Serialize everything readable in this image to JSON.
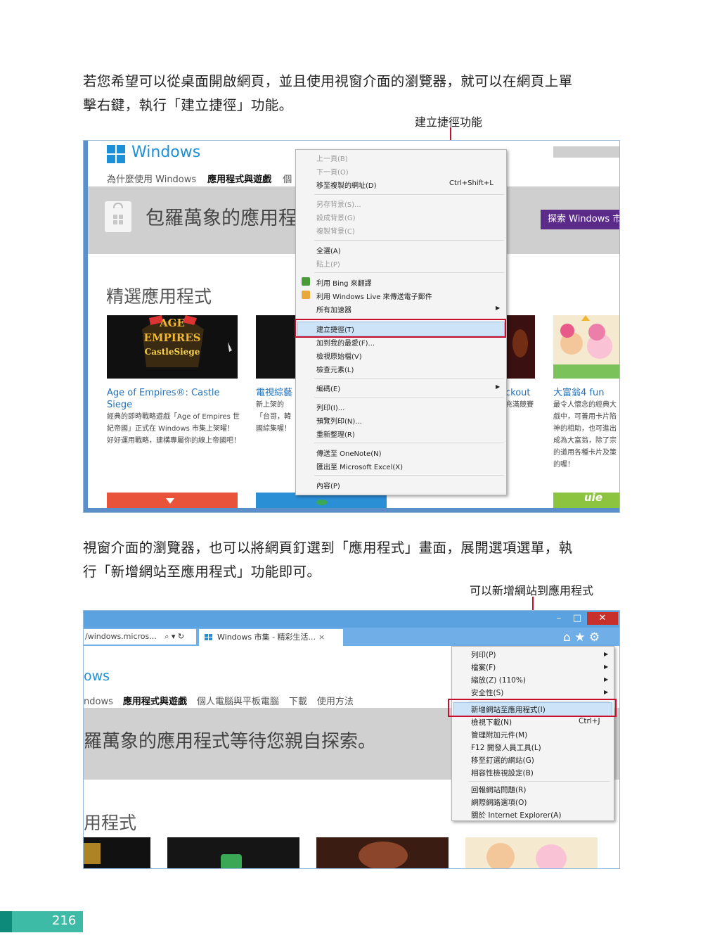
{
  "para1": {
    "line1": "若您希望可以從桌面開啟網頁，並且使用視窗介面的瀏覽器，就可以在網頁上單",
    "line2": "擊右鍵，執行「建立捷徑」功能。"
  },
  "callout1": "建立捷徑功能",
  "shot1": {
    "brand": "Windows",
    "nav_item1": "為什麼使用 Windows",
    "nav_item2": "應用程式與遊戲",
    "nav_item3": "個",
    "hero": "包羅萬象的應用程式",
    "explore": "探索 Windows 市",
    "section": "精選應用程式",
    "apps": [
      {
        "title": "Age of Empires®: Castle Siege",
        "desc": "經典的即時戰略遊戲「Age of Empires 世紀帝國」正式在 Windows 市集上架曜！好好運用戰略，建構專屬你的線上帝國吧！"
      },
      {
        "title": "電視綜藝",
        "desc": "新上架的「台哥，韓國綜集喔！"
      },
      {
        "title": "ckout",
        "desc": "充滿競賽"
      },
      {
        "title": "大富翁4 fun",
        "desc": "最令人懷念的經典大戲中，可善用卡片陷神的相助，也可進出成為大富翁，除了宗的道用各種卡片及策的喔！"
      }
    ],
    "tile_logo": {
      "line1": "AGE",
      "line2": "EMPIRES",
      "line3": "CastleSiege"
    },
    "tile_bottom_text": "uie",
    "menu": {
      "back": "上一頁(B)",
      "forward": "下一頁(O)",
      "goto_copied": "移至複製的網址(D)",
      "goto_copied_shortcut": "Ctrl+Shift+L",
      "save_bg": "另存背景(S)...",
      "set_bg": "設成背景(G)",
      "copy_bg": "複製背景(C)",
      "select_all": "全選(A)",
      "paste": "貼上(P)",
      "bing": "利用 Bing 來翻譯",
      "email": "利用 Windows Live 來傳送電子郵件",
      "accelerators": "所有加速器",
      "create_shortcut": "建立捷徑(T)",
      "add_favorites": "加到我的最愛(F)...",
      "view_source": "檢視原始檔(V)",
      "inspect": "檢查元素(L)",
      "encoding": "編碼(E)",
      "print": "列印(I)...",
      "print_preview": "預覽列印(N)...",
      "refresh": "重新整理(R)",
      "onenote": "傳送至 OneNote(N)",
      "excel": "匯出至 Microsoft Excel(X)",
      "properties": "內容(P)"
    }
  },
  "para2": {
    "line1": "視窗介面的瀏覽器，也可以將網頁釘選到「應用程式」畫面，展開選項選單，執",
    "line2": "行「新增網站至應用程式」功能即可。"
  },
  "callout2": "可以新增網站到應用程式",
  "shot2": {
    "minimize": "–",
    "maximize": "□",
    "close": "✕",
    "address": "/windows.micros...",
    "address_icons": "⌕ ▾ ↻",
    "tab_title": "Windows 市集 - 精彩生活...",
    "tab_close": "×",
    "toolbar_icons": "⌂ ★ ⚙",
    "brand": "ows",
    "nav": [
      "ndows",
      "應用程式與遊戲",
      "個人電腦與平板電腦",
      "下載",
      "使用方法"
    ],
    "hero": "羅萬象的應用程式等待您親自探索。",
    "section": "用程式",
    "menu": {
      "print": "列印(P)",
      "file": "檔案(F)",
      "zoom": "縮放(Z) (110%)",
      "safety": "安全性(S)",
      "add_site": "新增網站至應用程式(I)",
      "downloads": "檢視下載(N)",
      "downloads_shortcut": "Ctrl+J",
      "addons": "管理附加元件(M)",
      "f12": "F12 開發人員工具(L)",
      "pinned": "移至釘選的網站(G)",
      "compat": "相容性檢視設定(B)",
      "report": "回報網站問題(R)",
      "options": "網際網路選項(O)",
      "about": "關於 Internet Explorer(A)"
    }
  },
  "page_number": "216"
}
